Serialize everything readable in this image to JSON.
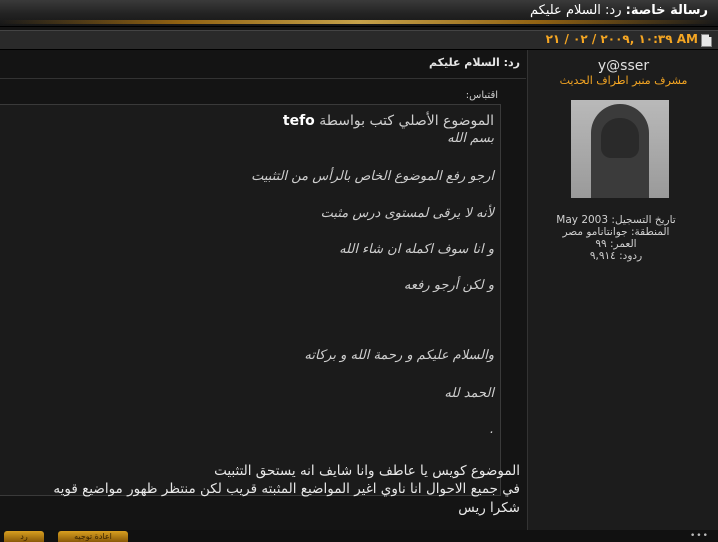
{
  "header": {
    "private_message": "رسالة خاصة:",
    "title": "رد: السلام عليكم",
    "post_date": "AM ١٠:٣٩ ,٢٠٠٩ / ٠٢ / ٢١"
  },
  "user": {
    "username": "y@sser",
    "title": "مشرف منبر اطراف الحديث",
    "join_date": "تاريخ التسجيل: May 2003",
    "location": "المنطقة: جوانتانامو مصر",
    "age": "العمر: ٩٩",
    "posts": "ردود: ٩,٩١٤"
  },
  "post": {
    "title": "رد: السلام عليكم",
    "quote_label": "اقتباس:",
    "quote_header_prefix": "الموضوع الأصلي كتب بواسطة",
    "quote_author": "tefo",
    "quote_lines": [
      "بسم الله",
      "ارجو رفع الموضوع الخاص بالرأس من التثبيت",
      "لأنه لا يرقى لمستوى درس مثبت",
      "و انا سوف اكمله ان شاء الله",
      "و لكن أرجو رفعه",
      "والسلام عليكم و رحمة الله و بركاته",
      "الحمد لله",
      "."
    ],
    "body_lines": [
      "الموضوع كويس يا عاطف وانا شايف انه يستحق التثبيت",
      "في جميع الاحوال انا ناوي اغير المواضيع المثبته قريب لكن منتظر ظهور مواضيع قويه",
      "شكرا ريس"
    ]
  },
  "buttons": {
    "reply_with_quote": "اعادة توجيه",
    "reply": "رد"
  },
  "colors": {
    "accent": "#f5a623",
    "background": "#141414",
    "panel": "#1c1c1c"
  }
}
